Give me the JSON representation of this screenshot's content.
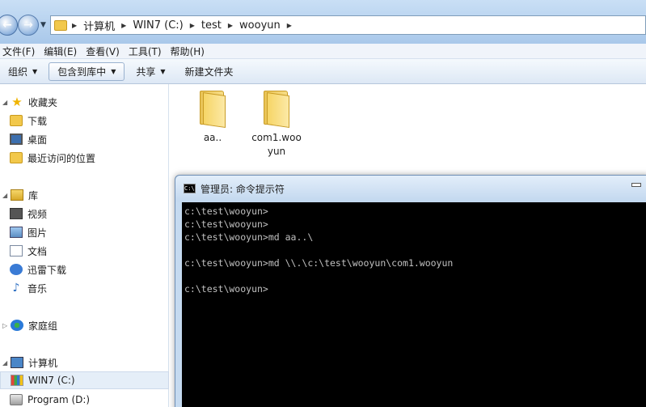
{
  "address": {
    "crumbs": [
      "计算机",
      "WIN7 (C:)",
      "test",
      "wooyun"
    ]
  },
  "menu": [
    "文件(F)",
    "编辑(E)",
    "查看(V)",
    "工具(T)",
    "帮助(H)"
  ],
  "toolbar": {
    "organize": "组织",
    "include_in_library": "包含到库中",
    "share": "共享",
    "new_folder": "新建文件夹"
  },
  "sidebar": {
    "favorites": "收藏夹",
    "downloads": "下载",
    "desktop": "桌面",
    "recent": "最近访问的位置",
    "libraries": "库",
    "videos": "视频",
    "pictures": "图片",
    "documents": "文档",
    "thunder": "迅雷下载",
    "music": "音乐",
    "homegroup": "家庭组",
    "computer": "计算机",
    "drive_c": "WIN7 (C:)",
    "drive_d": "Program (D:)"
  },
  "files": [
    {
      "line1": "aa..",
      "line2": ""
    },
    {
      "line1": "com1.woo",
      "line2": "yun"
    }
  ],
  "cmd": {
    "title": "管理员: 命令提示符",
    "icon_text": "C:\\",
    "lines": [
      "c:\\test\\wooyun>",
      "c:\\test\\wooyun>",
      "c:\\test\\wooyun>md aa..\\",
      "",
      "c:\\test\\wooyun>md \\\\.\\c:\\test\\wooyun\\com1.wooyun",
      "",
      "c:\\test\\wooyun>"
    ]
  }
}
